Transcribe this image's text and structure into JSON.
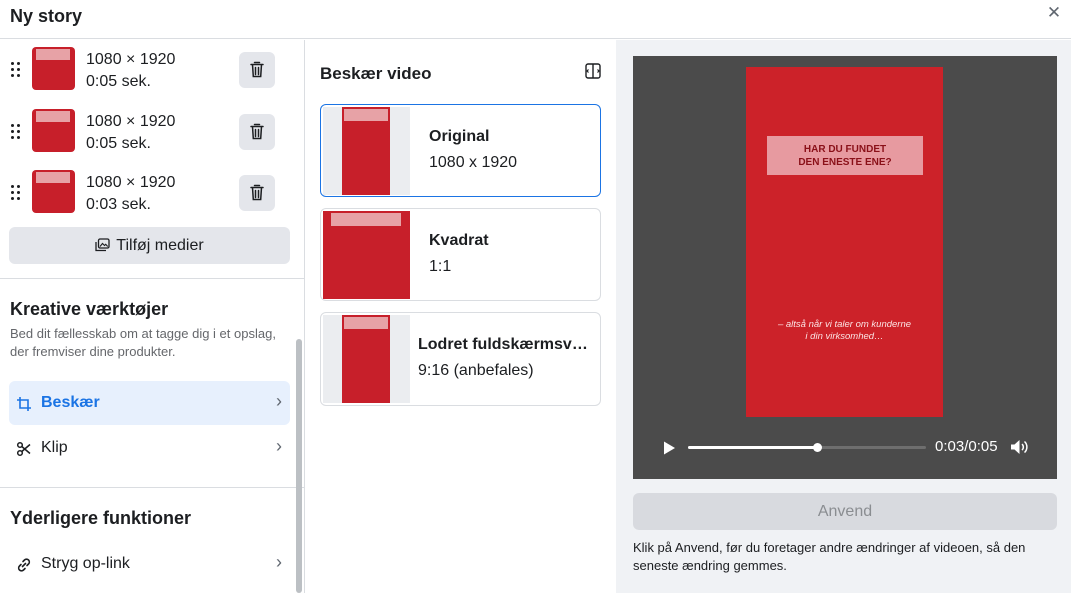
{
  "header": {
    "title": "Ny story",
    "close_icon": "close-icon"
  },
  "media": [
    {
      "size": "1080 × 1920",
      "duration": "0:05 sek."
    },
    {
      "size": "1080 × 1920",
      "duration": "0:05 sek."
    },
    {
      "size": "1080 × 1920",
      "duration": "0:03 sek."
    }
  ],
  "add_media_label": "Tilføj medier",
  "creative": {
    "title": "Kreative værktøjer",
    "description": "Bed dit fællesskab om at tagge dig i et opslag, der fremviser dine produkter.",
    "tools": [
      {
        "label": "Beskær",
        "icon": "crop-icon",
        "active": true
      },
      {
        "label": "Klip",
        "icon": "scissors-icon",
        "active": false
      }
    ]
  },
  "additional": {
    "title": "Yderligere funktioner",
    "items": [
      {
        "label": "Stryg op-link",
        "icon": "link-icon"
      }
    ]
  },
  "crop": {
    "title": "Beskær video",
    "options": [
      {
        "name": "Original",
        "sub": "1080 x 1920",
        "selected": true
      },
      {
        "name": "Kvadrat",
        "sub": "1:1",
        "selected": false
      },
      {
        "name": "Lodret fuldskærmsvi...",
        "sub": "9:16 (anbefales)",
        "selected": false
      }
    ]
  },
  "preview": {
    "headline_line1": "HAR DU FUNDET",
    "headline_line2": "DEN ENESTE ENE?",
    "caption_line1": "– altså når vi taler om kunderne",
    "caption_line2": "i din virksomhed…",
    "time": "0:03/0:05",
    "progress": 0.54
  },
  "apply_label": "Anvend",
  "note": "Klik på Anvend, før du foretager andre ændringer af videoen, så den seneste ændring gemmes.",
  "colors": {
    "accent": "#1b74e4",
    "video_red": "#cc2229"
  }
}
